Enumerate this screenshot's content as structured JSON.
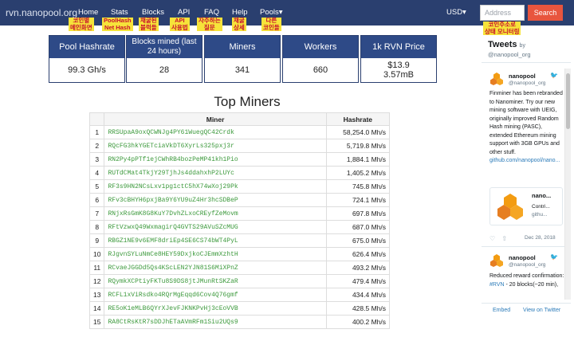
{
  "brand": "rvn.nanopool.org",
  "nav": [
    {
      "label": "Home",
      "note": "코인별\n메인화면"
    },
    {
      "label": "Stats",
      "note": "PoolHash\nNet Hash"
    },
    {
      "label": "Blocks",
      "note": "채굴된\n블럭들"
    },
    {
      "label": "API",
      "note": "API\n사용법"
    },
    {
      "label": "FAQ",
      "note": "자주하는\n질문"
    },
    {
      "label": "Help",
      "note": "채굴\n상세"
    },
    {
      "label": "Pools▾",
      "note": "다른\n코인들"
    }
  ],
  "currency": "USD▾",
  "search": {
    "placeholder": "Address",
    "button": "Search",
    "note": "코인주소로\n상태 모니터링"
  },
  "stats": [
    {
      "title": "Pool Hashrate",
      "value": "99.3 Gh/s"
    },
    {
      "title": "Blocks mined (last 24 hours)",
      "value": "28"
    },
    {
      "title": "Miners",
      "value": "341"
    },
    {
      "title": "Workers",
      "value": "660"
    },
    {
      "title": "1k RVN Price",
      "value": "$13.9\n3.57mB"
    }
  ],
  "top_miners": {
    "title": "Top Miners",
    "headers": [
      "",
      "Miner",
      "Hashrate"
    ],
    "rows": [
      [
        "1",
        "RRSUpaA9oxQCWNJg4PY61WuegQC42Crdk",
        "58,254.0 Mh/s"
      ],
      [
        "2",
        "RQcFG3hkYGETciaVkDT6XyrLs325pxj3r",
        "5,719.8 Mh/s"
      ],
      [
        "3",
        "RN2Py4pPTf1ejCWhRB4bozPeMP41kh1Pio",
        "1,884.1 Mh/s"
      ],
      [
        "4",
        "RUTdCMat4TkjY29TjhJs4ddahxhP2LUYc",
        "1,405.2 Mh/s"
      ],
      [
        "5",
        "RF3s9HN2NCsLxv1pg1ctC5hX74wXoj29Pk",
        "745.8 Mh/s"
      ],
      [
        "6",
        "RFv3cBHYH6pxjBa9Y6YU9uZ4Hr3hcSDBeP",
        "724.1 Mh/s"
      ],
      [
        "7",
        "RNjxRsGmK8G8KuY7DvhZLxoCREyfZeMovm",
        "697.8 Mh/s"
      ],
      [
        "8",
        "RFtVzwxQ49WxmagirQ4GVTS29AVuSZcMUG",
        "687.0 Mh/s"
      ],
      [
        "9",
        "RBGZ1NE9v6EMF8driEp4SE6CS74bWT4PyL",
        "675.0 Mh/s"
      ],
      [
        "10",
        "RJgvnSYLuNmCe8HEY59DxjkoCJEmmXzhtH",
        "626.4 Mh/s"
      ],
      [
        "11",
        "RCvaeJGGDd5Qs4KScLEN2YJN81S6MiXPnZ",
        "493.2 Mh/s"
      ],
      [
        "12",
        "RQymkXCPtiyFKTu8S9DS8jtJMunRtSKZaR",
        "479.4 Mh/s"
      ],
      [
        "13",
        "RCFL1xViRsdko4RQrMgEqqd6Cov4Q76gmf",
        "434.4 Mh/s"
      ],
      [
        "14",
        "RE5oK1eMLB6QYrXJevFJKNKPvHj3cEoVVB",
        "428.5 Mh/s"
      ],
      [
        "15",
        "RA8CtRsKtR7sDDJhETaAVmRFm1Siu2UQs9",
        "400.2 Mh/s"
      ]
    ]
  },
  "twitter": {
    "title": "Tweets",
    "by": "by",
    "handle_top": "@nanopool_org",
    "name": "nanopool",
    "handle": "@nanopool_org",
    "tweet1_text": "Finminer has been rebranded to Nanominer. Try our new mining software with UEIG, originally improved Random Hash mining (PASC), extended Ethereum mining support with 3GB GPUs and other stuff.",
    "tweet1_link": "github.com/nanopool/nano...",
    "card_title": "nano...",
    "card_desc": "Contri...",
    "card_url": "githu...",
    "tweet1_date": "Dec 28, 2018",
    "tweet2_text": "Reduced reward confirmation: ",
    "tweet2_tag": "#RVN",
    "tweet2_rest": " - 20 blocks(~20 min),",
    "footer_embed": "Embed",
    "footer_view": "View on Twitter",
    "colors": {
      "accent": "#1da1f2",
      "link": "#2b7bb9",
      "logo": "#f39c12"
    }
  },
  "colors": {
    "navbar": "#2a3f6f",
    "card_header": "#2e4a87",
    "miner_link": "#3d9a3d",
    "search": "#e8553e",
    "note_bg": "#f6e33a",
    "note_text": "#c8102e"
  }
}
